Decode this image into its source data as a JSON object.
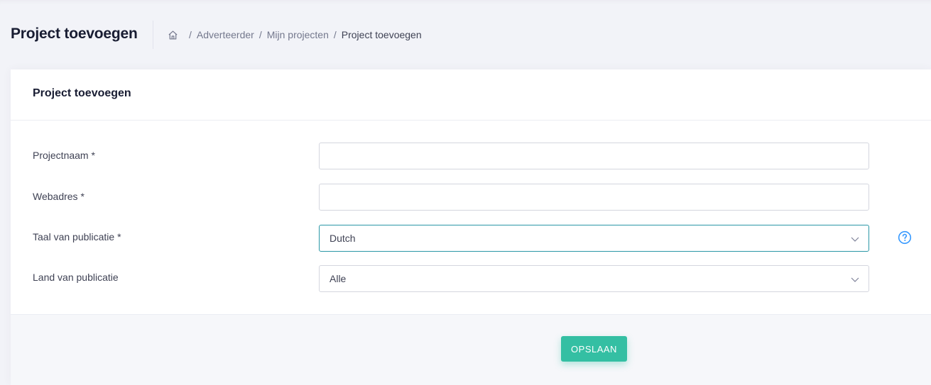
{
  "header": {
    "title": "Project toevoegen",
    "breadcrumb": {
      "home_icon": "home-icon",
      "separator": "/",
      "items": [
        "Adverteerder",
        "Mijn projecten",
        "Project toevoegen"
      ]
    }
  },
  "card": {
    "title": "Project toevoegen",
    "fields": {
      "project_name": {
        "label": "Projectnaam *",
        "value": "",
        "placeholder": ""
      },
      "web_address": {
        "label": "Webadres *",
        "value": "",
        "placeholder": ""
      },
      "language": {
        "label": "Taal van publicatie *",
        "selected": "Dutch",
        "help_icon": "question-circle-icon"
      },
      "country": {
        "label": "Land van publicatie",
        "selected": "Alle"
      }
    },
    "save_label": "OPSLAAN"
  },
  "colors": {
    "accent": "#34bfa3",
    "focus_border": "#2a97a6",
    "help_icon": "#3699ff"
  }
}
